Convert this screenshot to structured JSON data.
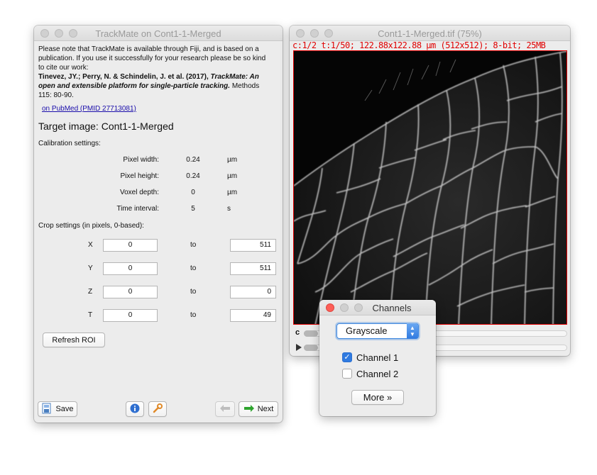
{
  "trackmate": {
    "title": "TrackMate on Cont1-1-Merged",
    "notice_lines": [
      "Please note that TrackMate is available through Fiji, and is based on a",
      "publication. If you use it successfully for your research please be so kind",
      "to cite our work:"
    ],
    "citation_authors": "Tinevez, JY.; Perry, N. & Schindelin, J. et al. (2017),",
    "citation_title": "TrackMate: An open and extensible platform for single-particle tracking.",
    "citation_journal": "Methods 115: 80-90.",
    "citation_title_line1": "TrackMate: An",
    "citation_line2_title": "open and extensible platform for single-particle tracking.",
    "citation_line2_journal": " Methods",
    "citation_line3": "115: 80-90.",
    "pubmed_link": "on PubMed (PMID 27713081)",
    "target_image": "Target image: Cont1-1-Merged",
    "calibration_label": "Calibration settings:",
    "calibration": [
      {
        "label": "Pixel width:",
        "value": "0.24",
        "unit": "µm"
      },
      {
        "label": "Pixel height:",
        "value": "0.24",
        "unit": "µm"
      },
      {
        "label": "Voxel depth:",
        "value": "0",
        "unit": "µm"
      },
      {
        "label": "Time interval:",
        "value": "5",
        "unit": "s"
      }
    ],
    "crop_label": "Crop settings (in pixels, 0-based):",
    "crop": [
      {
        "axis": "X",
        "from": "0",
        "to_label": "to",
        "to": "511"
      },
      {
        "axis": "Y",
        "from": "0",
        "to_label": "to",
        "to": "511"
      },
      {
        "axis": "Z",
        "from": "0",
        "to_label": "to",
        "to": "0"
      },
      {
        "axis": "T",
        "from": "0",
        "to_label": "to",
        "to": "49"
      }
    ],
    "refresh_button": "Refresh ROI",
    "save_button": "Save",
    "next_button": "Next"
  },
  "image_window": {
    "title": "Cont1-1-Merged.tif (75%)",
    "info": "c:1/2 t:1/50; 122.88x122.88 µm (512x512); 8-bit; 25MB",
    "channel_slider_letter": "c"
  },
  "channels": {
    "title": "Channels",
    "mode": "Grayscale",
    "channel1": "Channel 1",
    "channel1_checked": true,
    "channel2": "Channel 2",
    "channel2_checked": false,
    "more_button": "More »"
  },
  "colors": {
    "info_red": "#e00000",
    "accent_blue": "#2f7ae0",
    "close_red": "#fd5f57"
  }
}
